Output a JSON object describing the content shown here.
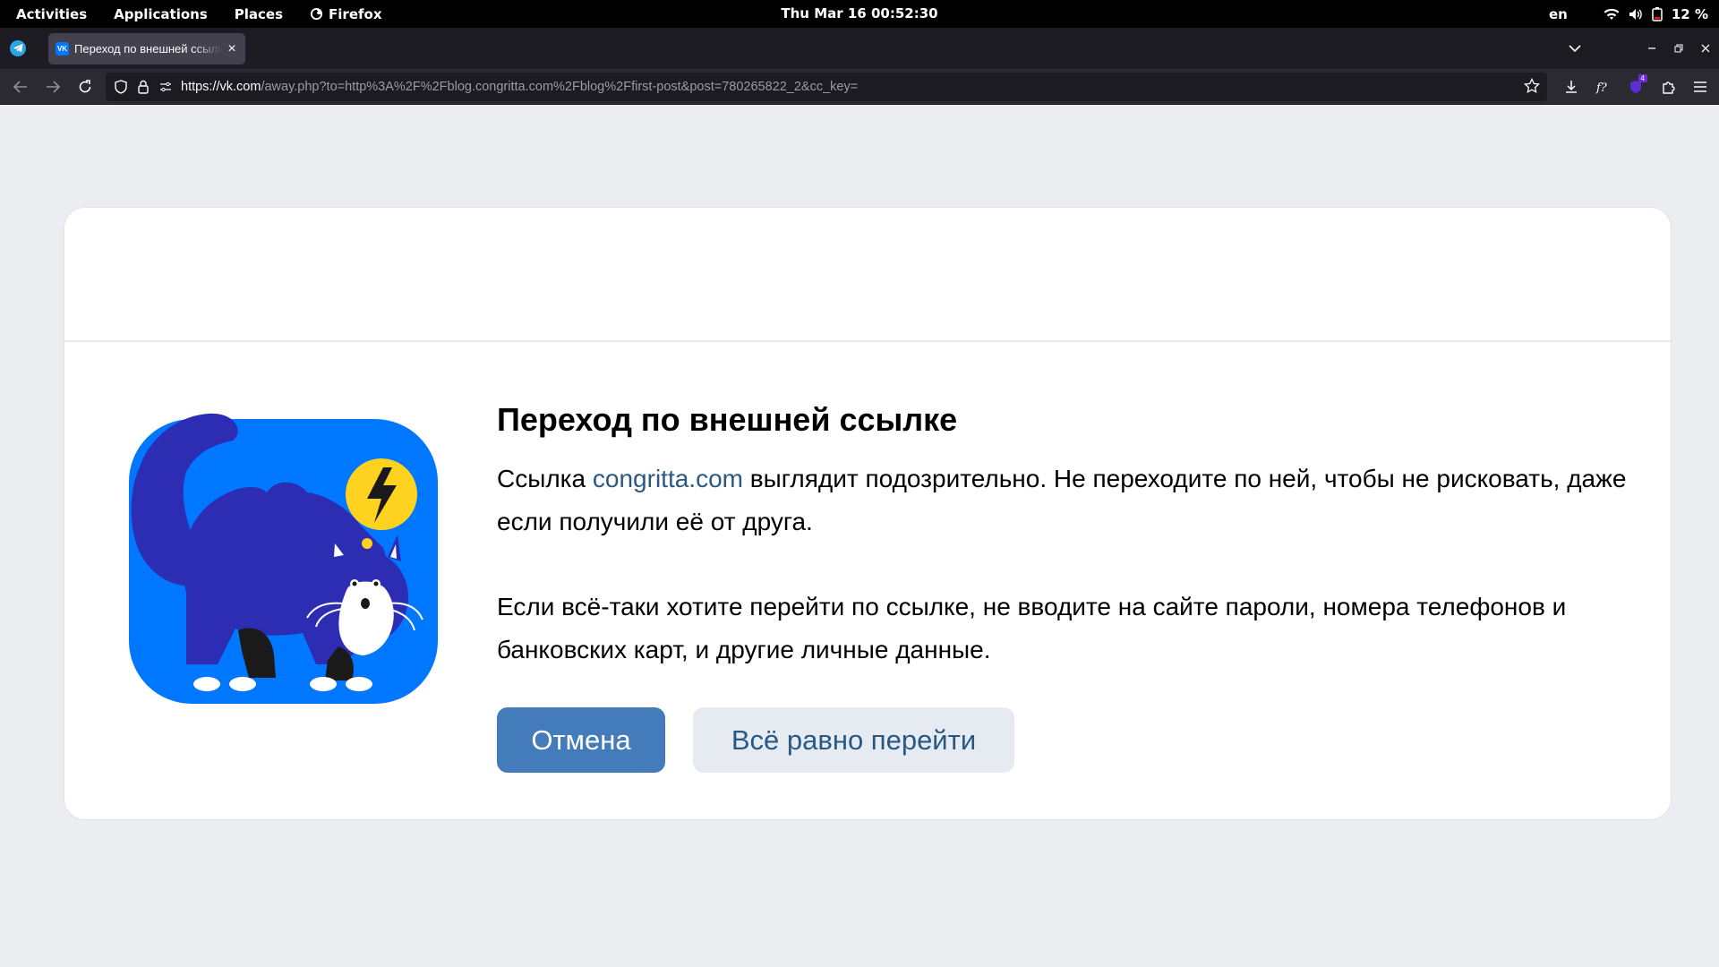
{
  "system_bar": {
    "activities": "Activities",
    "applications": "Applications",
    "places": "Places",
    "firefox": "Firefox",
    "clock": "Thu Mar 16  00:52:30",
    "language": "en",
    "battery": "12 %"
  },
  "browser": {
    "tab_title": "Переход по внешней ссылке",
    "tab_favicon_text": "VK",
    "new_tab_label": "+",
    "url_host": "https://vk.com",
    "url_rest": "/away.php?to=http%3A%2F%2Fblog.congritta.com%2Fblog%2Ffirst-post&post=780265822_2&cc_key=",
    "extension_badge": "4"
  },
  "page": {
    "title": "Переход по внешней ссылке",
    "warning_prefix": "Ссылка ",
    "warning_domain": "congritta.com",
    "warning_suffix": " выглядит подозрительно. Не переходите по ней, чтобы не рисковать, даже если получили её от друга.",
    "advice": "Если всё-таки хотите перейти по ссылке, не вводите на сайте пароли, номера телефонов и банковских карт, и другие личные данные.",
    "cancel_button": "Отмена",
    "proceed_button": "Всё равно перейти"
  },
  "colors": {
    "primary_button": "#447bba",
    "link": "#2a5885",
    "illustration_bg": "#0077ff",
    "cat": "#2d2db4",
    "alert_bubble": "#ffd21f"
  }
}
